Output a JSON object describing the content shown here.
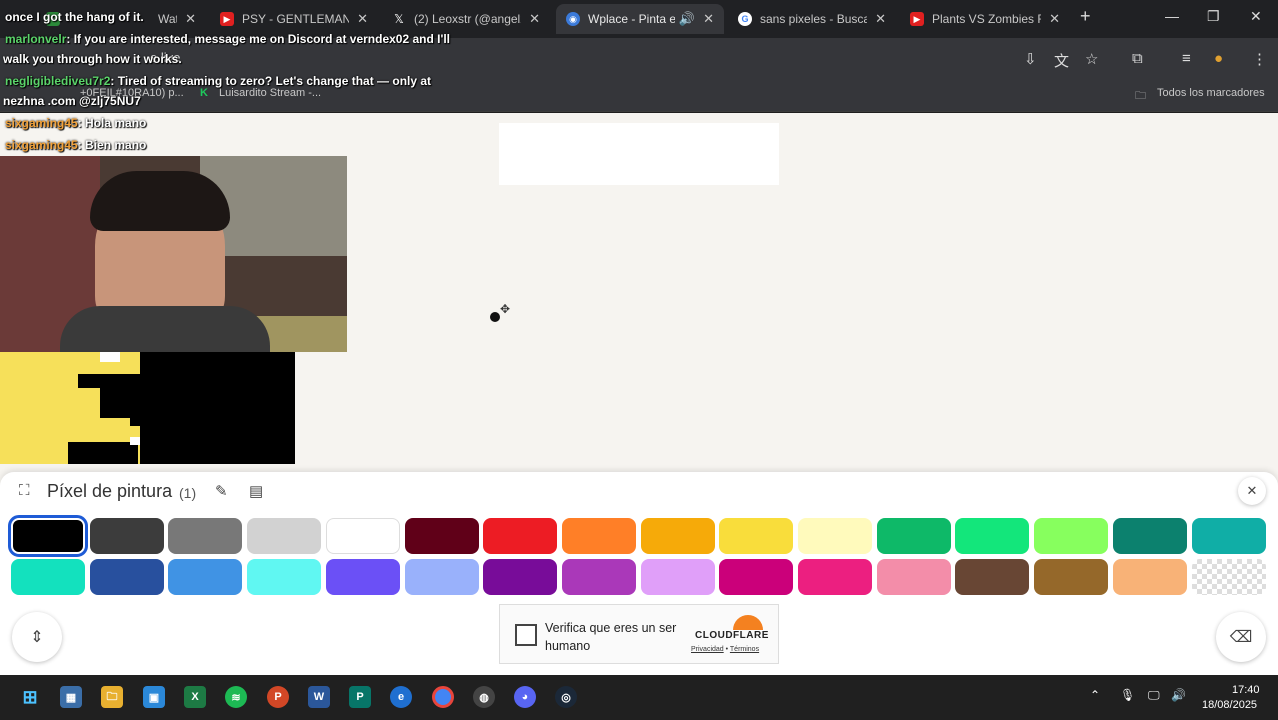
{
  "browser": {
    "tabs": [
      {
        "title": "Watc",
        "icon": "green-box-icon",
        "active": false
      },
      {
        "title": "PSY - GENTLEMAN M",
        "icon": "youtube-icon",
        "active": false
      },
      {
        "title": "(2) Leoxstr (@angel2",
        "icon": "x-icon",
        "active": false
      },
      {
        "title": "Wplace - Pinta el",
        "icon": "globe-icon",
        "active": true
      },
      {
        "title": "sans pixeles - Buscar",
        "icon": "google-icon",
        "active": false
      },
      {
        "title": "Plants VS Zombies R",
        "icon": "youtube-icon",
        "active": false
      }
    ],
    "url_fragment": "e.live",
    "bookmarks": [
      {
        "label": "+0FEIL#10RA10) p..."
      },
      {
        "label": "Luisardito Stream -..."
      }
    ],
    "all_bookmarks": "Todos los marcadores"
  },
  "chat": [
    {
      "user": "marlonvelr",
      "text": ": If you are interested, message me on Discord at verndex02 and I'll"
    },
    {
      "user": "",
      "text": "walk you through how it works."
    },
    {
      "user": "negligiblediveu7r2",
      "text": ": Tired of streaming to zero? Let's change that — only at"
    },
    {
      "user": "",
      "text": "nezhna .com @zlj75NU7"
    },
    {
      "user": "",
      "text": "once I got the hang of it."
    },
    {
      "user": "sixgaming45",
      "text": ": Hola mano"
    },
    {
      "user": "sixgaming45",
      "text": ": Bien mano"
    }
  ],
  "panel": {
    "title": "Píxel de pintura",
    "count": "(1)",
    "colors_row1": [
      "#000000",
      "#3c3c3c",
      "#787878",
      "#d2d2d2",
      "#ffffff",
      "#600018",
      "#ed1c24",
      "#ff7f27",
      "#f6aa09",
      "#f9dd3b",
      "#fffabc",
      "#0eb968",
      "#13e67b",
      "#87ff5e",
      "#0c816e",
      "#10aea6"
    ],
    "colors_row2": [
      "#13e1be",
      "#28509e",
      "#4093e4",
      "#60f7f2",
      "#6b50f6",
      "#99b1fb",
      "#780c99",
      "#aa38b9",
      "#e09ff9",
      "#cb007a",
      "#ec1f80",
      "#f38da9",
      "#684634",
      "#95682a",
      "#f8b277",
      "transparent"
    ],
    "selected_index": 0
  },
  "captcha": {
    "text": "Verifica que eres un ser humano",
    "brand": "CLOUDFLARE",
    "privacy": "Privacidad",
    "terms": "Términos"
  },
  "taskbar": {
    "time": "17:40",
    "date": "18/08/2025"
  }
}
